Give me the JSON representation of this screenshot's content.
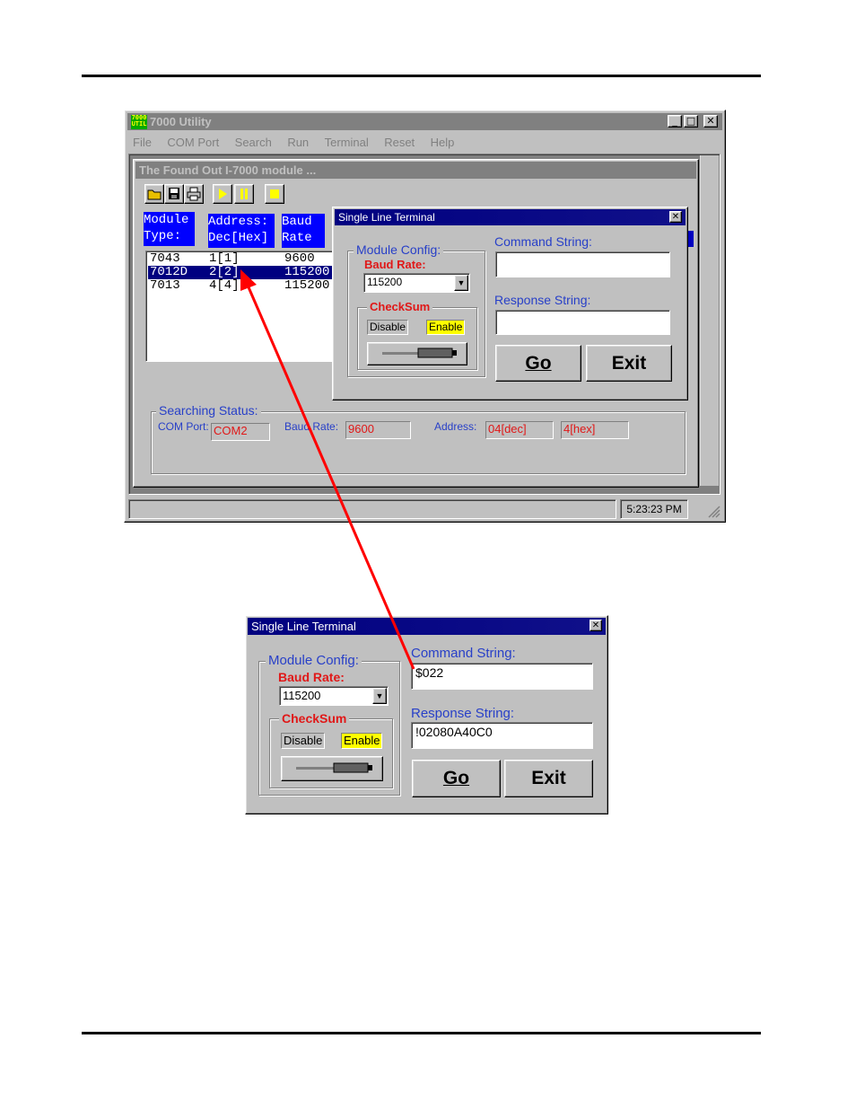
{
  "main_window": {
    "app_icon": "7000-util-icon",
    "title": "7000 Utility",
    "menu": [
      "File",
      "COM Port",
      "Search",
      "Run",
      "Terminal",
      "Reset",
      "Help"
    ],
    "panel_title": "The Found Out I-7000 module ...",
    "toolbar_icons": [
      "open-folder-icon",
      "save-disk-icon",
      "print-icon",
      "play-icon",
      "pause-icon",
      "stop-icon"
    ],
    "table": {
      "headers": [
        {
          "line1": "Module",
          "line2": "Type:"
        },
        {
          "line1": "Address:",
          "line2": "Dec[Hex]"
        },
        {
          "line1": "Baud",
          "line2": "Rate"
        }
      ],
      "rows": [
        {
          "type": "7043",
          "address": "1[1]",
          "baud": "9600"
        },
        {
          "type": "7012D",
          "address": "2[2]",
          "baud": "115200"
        },
        {
          "type": "7013",
          "address": "4[4]",
          "baud": "115200"
        }
      ]
    },
    "status": {
      "group_label": "Searching Status:",
      "com_port_label": "COM Port:",
      "com_port_value": "COM2",
      "baud_rate_label": "Baud Rate:",
      "baud_rate_value": "9600",
      "address_label": "Address:",
      "address_dec": "04[dec]",
      "address_hex": "4[hex]"
    },
    "clock": "5:23:23 PM"
  },
  "terminal_small": {
    "title": "Single Line Terminal",
    "module_config_label": "Module Config:",
    "baud_rate_label": "Baud Rate:",
    "baud_rate_value": "115200",
    "checksum_label": "CheckSum",
    "disable_label": "Disable",
    "enable_label": "Enable",
    "command_label": "Command String:",
    "command_value": "",
    "response_label": "Response String:",
    "response_value": "",
    "go_label": "Go",
    "exit_label": "Exit"
  },
  "terminal_large": {
    "title": "Single Line Terminal",
    "module_config_label": "Module Config:",
    "baud_rate_label": "Baud Rate:",
    "baud_rate_value": "115200",
    "checksum_label": "CheckSum",
    "disable_label": "Disable",
    "enable_label": "Enable",
    "command_label": "Command String:",
    "command_value": "$022",
    "response_label": "Response String:",
    "response_value": "!02080A40C0",
    "go_label": "Go",
    "exit_label": "Exit"
  },
  "annotation": {
    "arrow_color": "#ff0000"
  },
  "colors": {
    "selection": "#000080",
    "status_red": "#e01818",
    "label_blue": "#2840c8",
    "highlight_yellow": "#ffff00"
  }
}
